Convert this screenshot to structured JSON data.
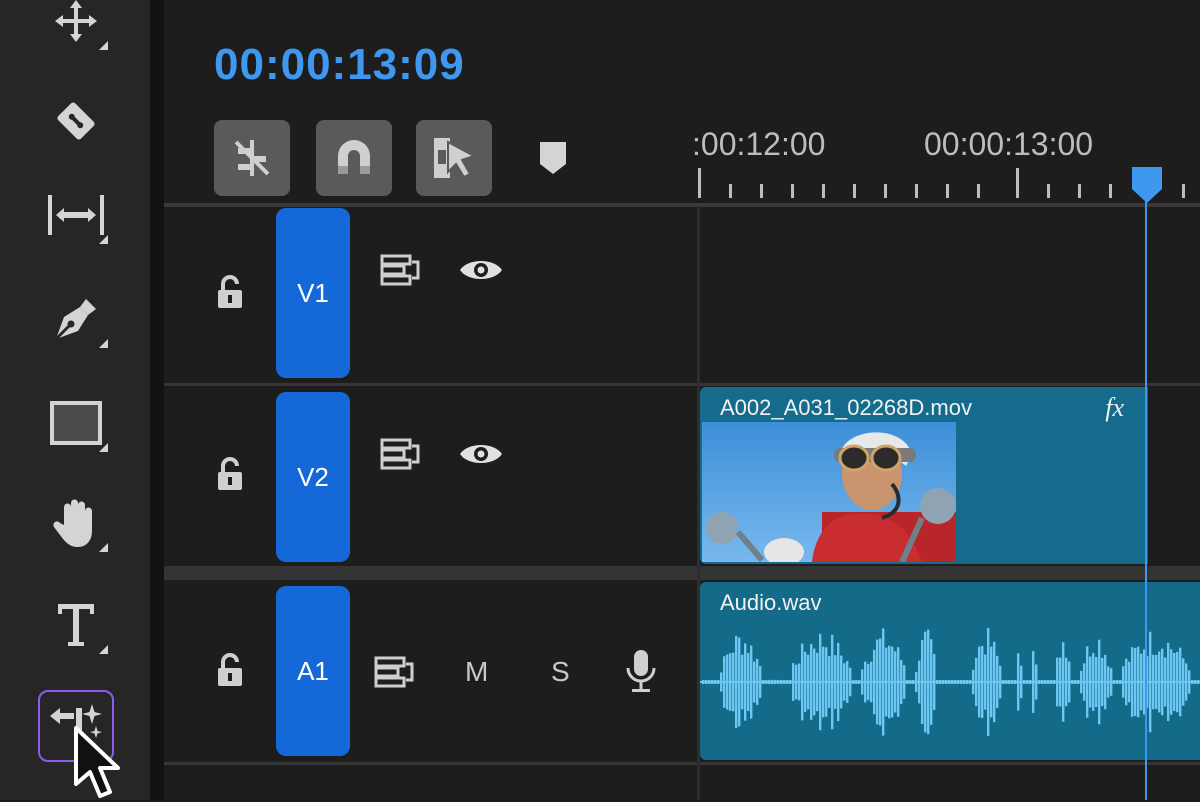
{
  "toolbar": {
    "tools": [
      {
        "name": "move-tool",
        "icon": "move-arrows-icon"
      },
      {
        "name": "razor-tool",
        "icon": "razor-blade-icon"
      },
      {
        "name": "slip-tool",
        "icon": "slip-icon"
      },
      {
        "name": "pen-tool",
        "icon": "pen-nib-icon"
      },
      {
        "name": "rectangle-tool",
        "icon": "rectangle-icon"
      },
      {
        "name": "hand-tool",
        "icon": "hand-icon"
      },
      {
        "name": "type-tool",
        "icon": "type-T-icon"
      },
      {
        "name": "generative-extend-tool",
        "icon": "generative-extend-icon",
        "selected": true
      }
    ]
  },
  "timeline": {
    "timecode": "00:00:13:09",
    "header_buttons": [
      {
        "name": "snap-linked-button",
        "icon": "linked-selection-icon"
      },
      {
        "name": "snap-button",
        "icon": "magnet-icon"
      },
      {
        "name": "linked-selection-button",
        "icon": "linked-cursor-icon"
      }
    ],
    "ruler": {
      "labels": [
        ":00:12:00",
        "00:00:13:00"
      ]
    },
    "playhead_color": "#3f98f0"
  },
  "tracks": [
    {
      "id": "V1",
      "label": "V1",
      "type": "video"
    },
    {
      "id": "V2",
      "label": "V2",
      "type": "video"
    },
    {
      "id": "A1",
      "label": "A1",
      "type": "audio",
      "mute_label": "M",
      "solo_label": "S"
    }
  ],
  "clips": {
    "video": {
      "name": "A002_A031_02268D.mov",
      "fx_label": "fx",
      "color": "#156b8c"
    },
    "audio": {
      "name": "Audio.wav",
      "color": "#146a89",
      "waveform_color": "#6cc8f2"
    }
  },
  "colors": {
    "accent": "#3f98f0",
    "track_label": "#1468d8",
    "selected_tool_border": "#8a5cf0"
  }
}
